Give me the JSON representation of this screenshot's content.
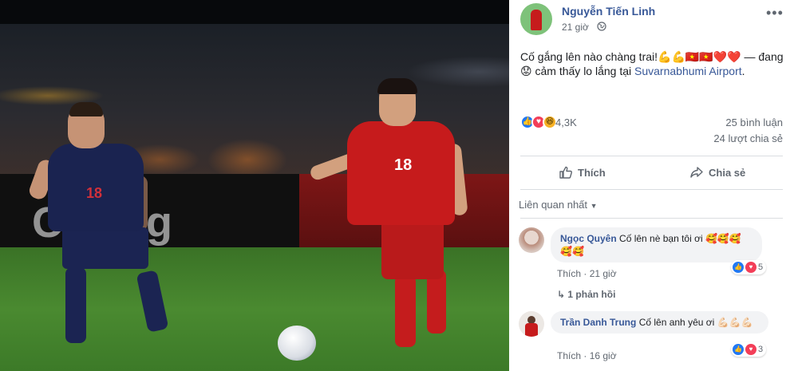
{
  "post": {
    "author": "Nguyễn Tiến Linh",
    "time": "21 giờ",
    "text_before": "Cố gắng lên nào chàng trai!",
    "emojis_line": "💪💪🇻🇳🇻🇳❤️❤️",
    "text_dash": " — đang ",
    "feeling_emoji": "😟",
    "feeling_text": " cảm thấy lo lắng tại ",
    "location": "Suvarnabhumi Airport",
    "location_end": ".",
    "reaction_count": "4,3K",
    "comments_count": "25 bình luận",
    "shares_count": "24 lượt chia sẻ",
    "like_label": "Thích",
    "share_label": "Chia sẻ"
  },
  "comments_section": {
    "sort_label": "Liên quan nhất",
    "comments": [
      {
        "name": "Ngọc Quyên",
        "text": "Cố lên nè bạn tôi ơi 🥰🥰🥰🥰🥰",
        "like_label": "Thích",
        "time": "21 giờ",
        "reaction_count": "5"
      },
      {
        "name": "Trần Danh Trung",
        "text": "Cố lên anh yêu ơi 💪🏻💪🏻💪🏻",
        "like_label": "Thích",
        "time": "16 giờ",
        "reaction_count": "3"
      }
    ],
    "replies_label": "1 phản hồi"
  },
  "photo": {
    "jersey_number_vn": "18",
    "jersey_number_thai": "18",
    "adboard_text": "Chang"
  },
  "colors": {
    "link": "#385898",
    "muted": "#606770",
    "vn_red": "#c61b1c",
    "thai_navy": "#1a2350"
  },
  "icons": [
    "globe-icon",
    "more-icon",
    "like-icon",
    "share-icon",
    "chevron-down-icon",
    "reply-arrow-icon"
  ]
}
